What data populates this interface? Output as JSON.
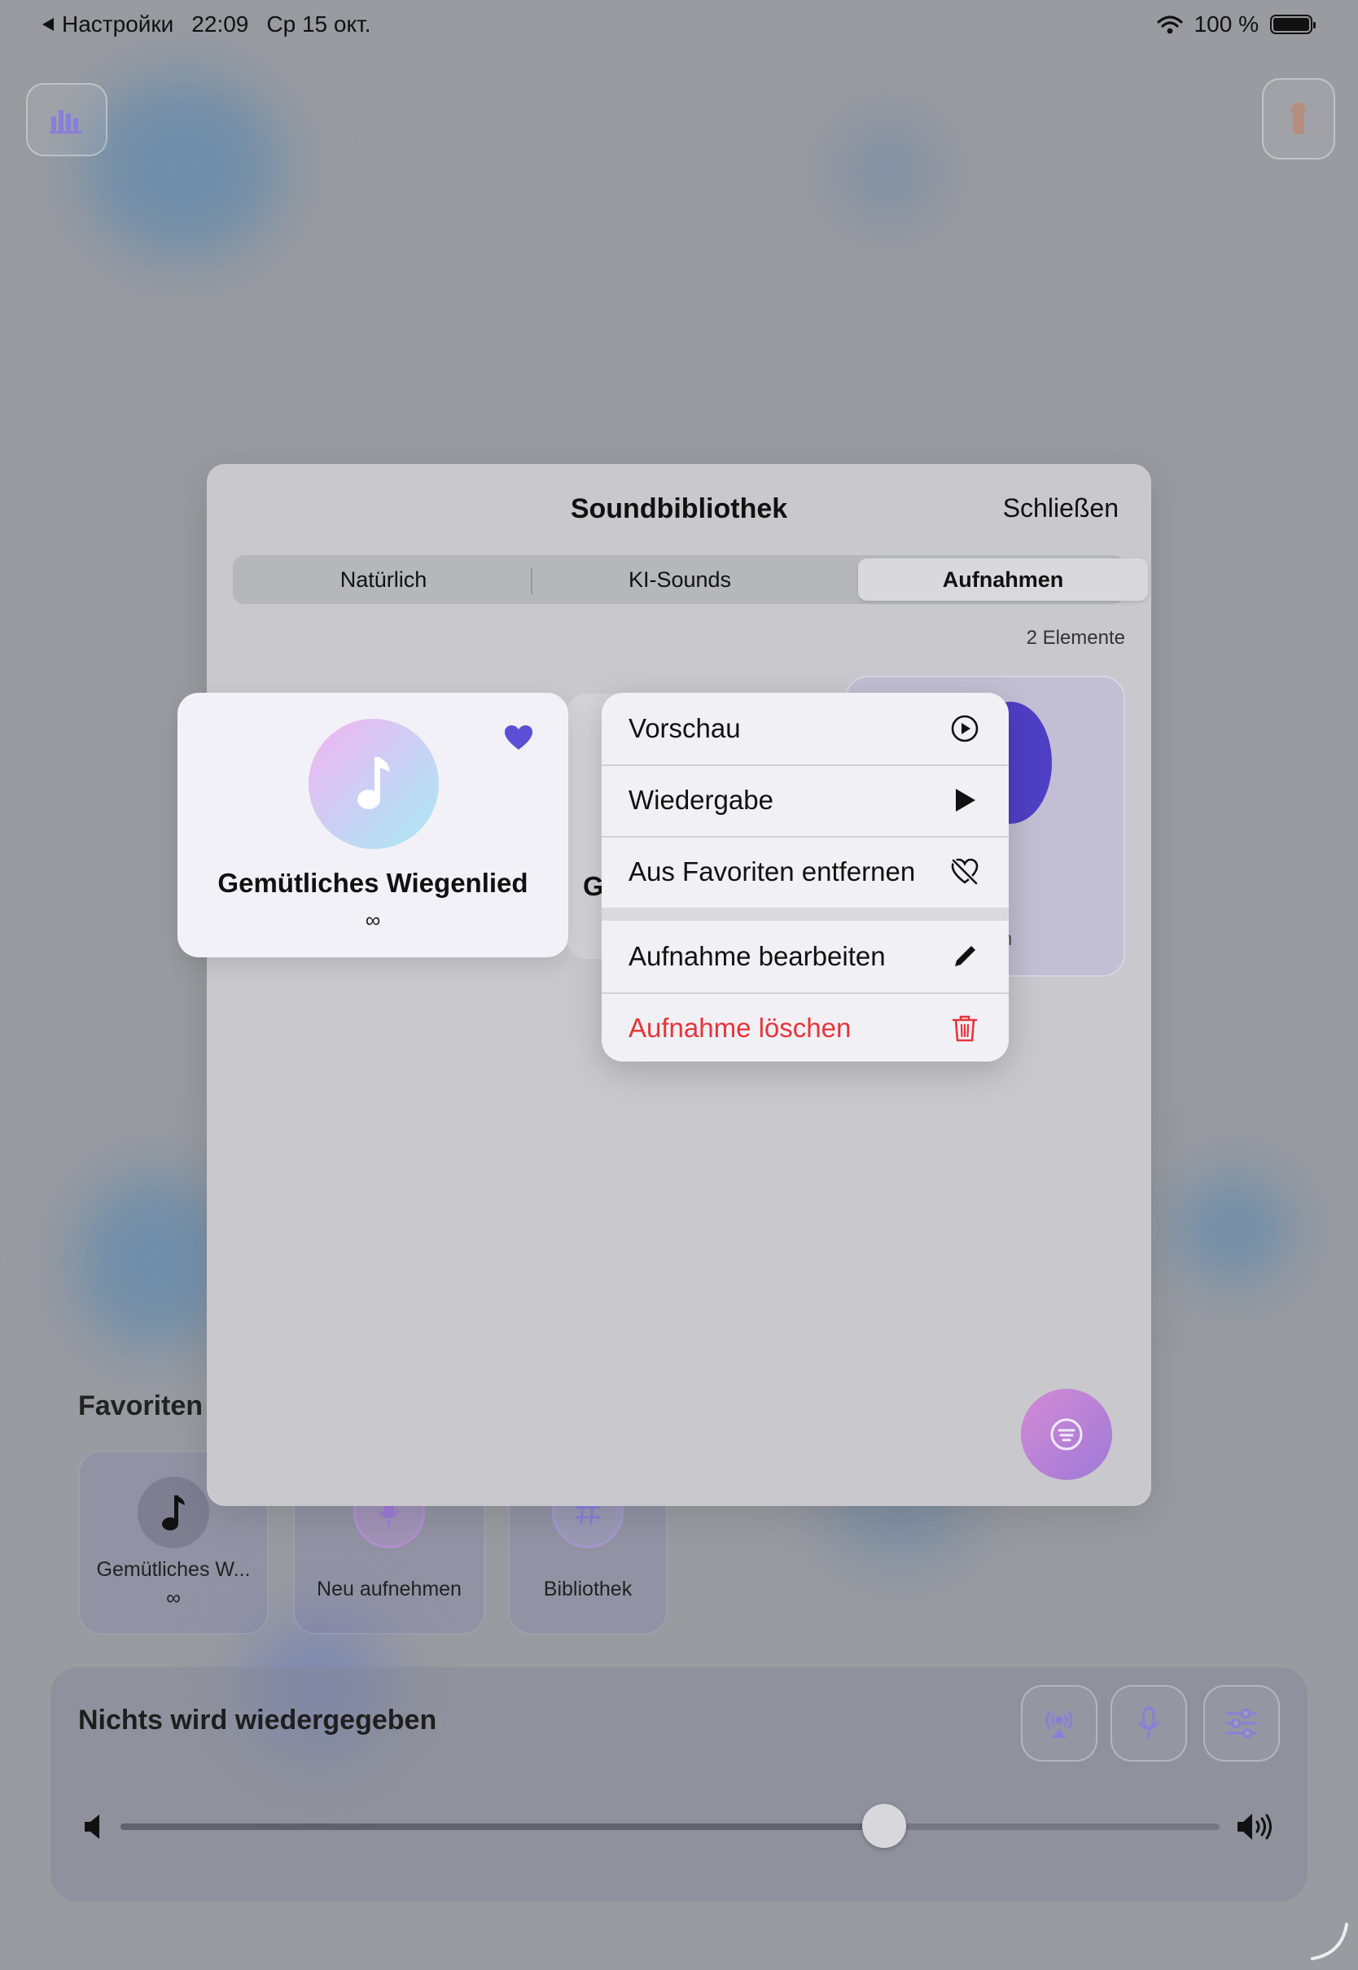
{
  "status_bar": {
    "back_app": "Настройки",
    "time": "22:09",
    "date": "Ср 15 окт.",
    "battery": "100 %"
  },
  "favorites": {
    "title": "Favoriten",
    "items": [
      {
        "label": "Gemütliches W...",
        "sub": "∞"
      },
      {
        "label": "Neu aufnehmen"
      },
      {
        "label": "Bibliothek"
      }
    ]
  },
  "player": {
    "status": "Nichts wird wiedergegeben",
    "volume": 0.695
  },
  "modal": {
    "title": "Soundbibliothek",
    "close": "Schließen",
    "tabs": [
      "Natürlich",
      "KI-Sounds",
      "Aufnahmen"
    ],
    "active_tab": "Aufnahmen",
    "count": "2 Elemente",
    "behind_left_fragment": "Gr",
    "behind_right_title": "men",
    "behind_right_sub": "ehmen"
  },
  "selected_card": {
    "title": "Gemütliches Wiegenlied",
    "sub": "∞",
    "favorited": true
  },
  "context_menu": {
    "items": [
      {
        "label": "Vorschau",
        "icon": "play-circle-icon"
      },
      {
        "label": "Wiedergabe",
        "icon": "play-icon"
      },
      {
        "label": "Aus Favoriten entfernen",
        "icon": "heart-slash-icon"
      },
      {
        "label": "Aufnahme bearbeiten",
        "icon": "pencil-icon"
      },
      {
        "label": "Aufnahme löschen",
        "icon": "trash-icon",
        "destructive": true
      }
    ]
  },
  "colors": {
    "accent": "#5b4fd6",
    "destructive": "#e8343b"
  }
}
